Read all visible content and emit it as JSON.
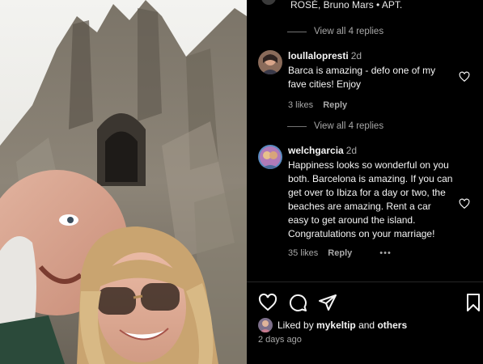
{
  "post": {
    "music_text": "ROSÉ, Bruno Mars • APT.",
    "photo_description_icon": "selfie-photo",
    "likes_prefix": "Liked by",
    "likes_user": "mykeltip",
    "likes_and": "and",
    "likes_others": "others",
    "date": "2 days ago"
  },
  "comments": [
    {
      "view_replies": "View all 4 replies"
    },
    {
      "username": "loullalopresti",
      "time": "2d",
      "text": "Barca is amazing - defo one of my fave cities! Enjoy",
      "likes": "3 likes",
      "reply": "Reply",
      "view_replies": "View all 4 replies"
    },
    {
      "username": "welchgarcia",
      "time": "2d",
      "text": "Happiness looks so wonderful on you both. Barcelona is amazing. If you can get over to Ibiza for a day or two, the beaches are amazing. Rent a car easy to get around the island. Congratulations on your marriage!",
      "likes": "35 likes",
      "reply": "Reply",
      "more": "•••"
    }
  ],
  "icons": {
    "like": "heart-icon",
    "comment": "comment-icon",
    "share": "send-icon",
    "save": "bookmark-icon"
  }
}
